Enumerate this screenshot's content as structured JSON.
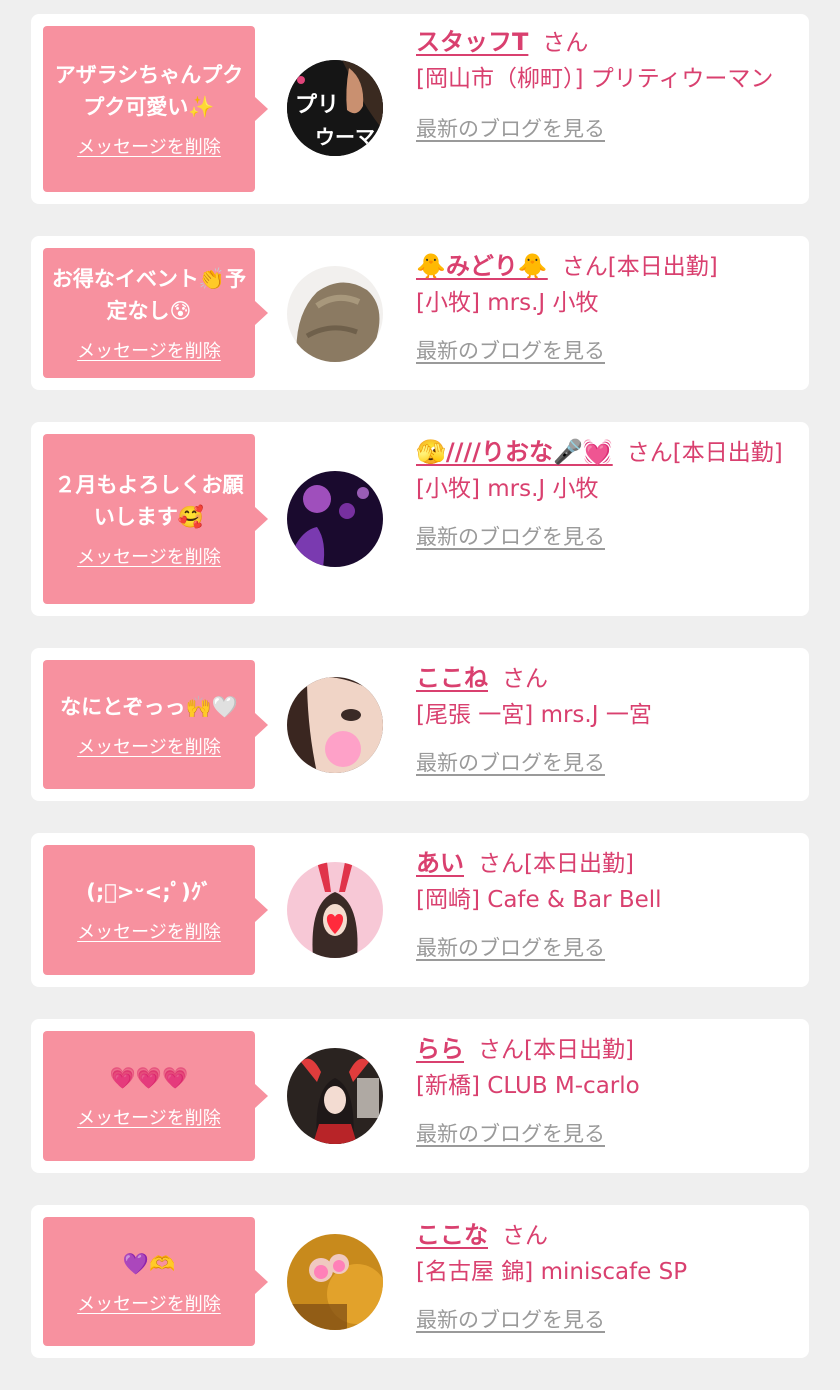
{
  "colors": {
    "accent": "#d9406f",
    "bubble": "#f7919f",
    "card": "#ffffff",
    "background": "#efefef",
    "link_gray": "#9a9a9a"
  },
  "entries": [
    {
      "message": "アザラシちゃんプクプク可愛い✨",
      "delete_label": "メッセージを削除",
      "avatar_icon": "shop-logo-pretty-woman-avatar",
      "name": "スタッフT",
      "suffix": "さん",
      "shop": "[岡山市（柳町）] プリティウーマン",
      "blog_label": "最新のブログを見る"
    },
    {
      "message": "お得なイベント👏予定なし😰",
      "delete_label": "メッセージを削除",
      "avatar_icon": "hair-photo-avatar",
      "name": "🐥みどり🐥",
      "suffix": "さん[本日出勤]",
      "shop": "[小牧] mrs.J 小牧",
      "blog_label": "最新のブログを見る"
    },
    {
      "message": "２月もよろしくお願いします🥰",
      "delete_label": "メッセージを削除",
      "avatar_icon": "purple-light-photo-avatar",
      "name": "🫣////りおな🎤💓",
      "suffix": "さん[本日出勤]",
      "shop": "[小牧] mrs.J 小牧",
      "blog_label": "最新のブログを見る"
    },
    {
      "message": "なにとぞっっ🙌🤍",
      "delete_label": "メッセージを削除",
      "avatar_icon": "selfie-photo-avatar",
      "name": "ここね",
      "suffix": "さん",
      "shop": "[尾張 一宮] mrs.J 一宮",
      "blog_label": "最新のブログを見る"
    },
    {
      "message": "(;ﾟ>ᵕ<;ﾟ)ｸﾞ",
      "delete_label": "メッセージを削除",
      "avatar_icon": "bunny-ears-photo-avatar",
      "name": "あい",
      "suffix": "さん[本日出勤]",
      "shop": "[岡崎] Cafe & Bar Bell",
      "blog_label": "最新のブログを見る"
    },
    {
      "message": "💗💗💗",
      "delete_label": "メッセージを削除",
      "avatar_icon": "red-costume-photo-avatar",
      "name": "らら",
      "suffix": "さん[本日出勤]",
      "shop": "[新橋] CLUB M-carlo",
      "blog_label": "最新のブログを見る"
    },
    {
      "message": "💜🫶",
      "delete_label": "メッセージを削除",
      "avatar_icon": "golden-photo-avatar",
      "name": "ここな",
      "suffix": "さん",
      "shop": "[名古屋 錦] miniscafe SP",
      "blog_label": "最新のブログを見る"
    }
  ]
}
